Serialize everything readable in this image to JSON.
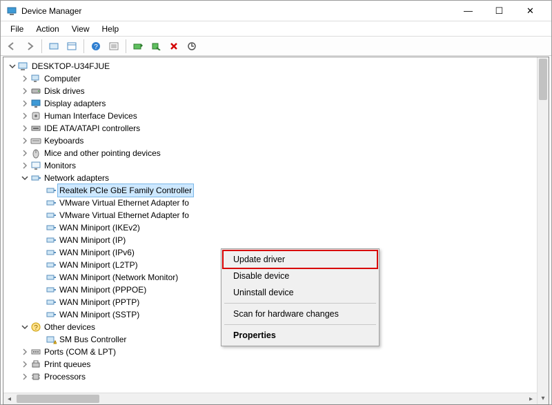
{
  "title": "Device Manager",
  "window_buttons": {
    "min": "—",
    "max": "☐",
    "close": "✕"
  },
  "menubar": [
    "File",
    "Action",
    "View",
    "Help"
  ],
  "toolbar_icons": [
    "back-icon",
    "forward-icon",
    "sep",
    "show-hidden-icon",
    "properties-pane-icon",
    "sep",
    "help-icon",
    "properties-icon",
    "sep",
    "update-driver-icon",
    "uninstall-icon",
    "delete-icon",
    "scan-hardware-icon"
  ],
  "root": {
    "label": "DESKTOP-U34FJUE",
    "expanded": true,
    "children": [
      {
        "label": "Computer",
        "icon": "computer-icon"
      },
      {
        "label": "Disk drives",
        "icon": "disk-icon"
      },
      {
        "label": "Display adapters",
        "icon": "display-icon"
      },
      {
        "label": "Human Interface Devices",
        "icon": "hid-icon"
      },
      {
        "label": "IDE ATA/ATAPI controllers",
        "icon": "ide-icon"
      },
      {
        "label": "Keyboards",
        "icon": "keyboard-icon"
      },
      {
        "label": "Mice and other pointing devices",
        "icon": "mouse-icon"
      },
      {
        "label": "Monitors",
        "icon": "monitor-icon"
      },
      {
        "label": "Network adapters",
        "icon": "network-icon",
        "expanded": true,
        "children": [
          {
            "label": "Realtek PCIe GbE Family Controller",
            "selected": true
          },
          {
            "label": "VMware Virtual Ethernet Adapter fo"
          },
          {
            "label": "VMware Virtual Ethernet Adapter fo"
          },
          {
            "label": "WAN Miniport (IKEv2)"
          },
          {
            "label": "WAN Miniport (IP)"
          },
          {
            "label": "WAN Miniport (IPv6)"
          },
          {
            "label": "WAN Miniport (L2TP)"
          },
          {
            "label": "WAN Miniport (Network Monitor)"
          },
          {
            "label": "WAN Miniport (PPPOE)"
          },
          {
            "label": "WAN Miniport (PPTP)"
          },
          {
            "label": "WAN Miniport (SSTP)"
          }
        ]
      },
      {
        "label": "Other devices",
        "icon": "other-icon",
        "expanded": true,
        "children": [
          {
            "label": "SM Bus Controller",
            "icon": "warning-device-icon"
          }
        ]
      },
      {
        "label": "Ports (COM & LPT)",
        "icon": "ports-icon"
      },
      {
        "label": "Print queues",
        "icon": "printer-icon"
      },
      {
        "label": "Processors",
        "icon": "cpu-icon"
      }
    ]
  },
  "context_menu": {
    "items": [
      {
        "label": "Update driver",
        "highlight": true
      },
      {
        "label": "Disable device"
      },
      {
        "label": "Uninstall device"
      },
      {
        "sep": true
      },
      {
        "label": "Scan for hardware changes"
      },
      {
        "sep": true
      },
      {
        "label": "Properties",
        "bold": true
      }
    ]
  }
}
